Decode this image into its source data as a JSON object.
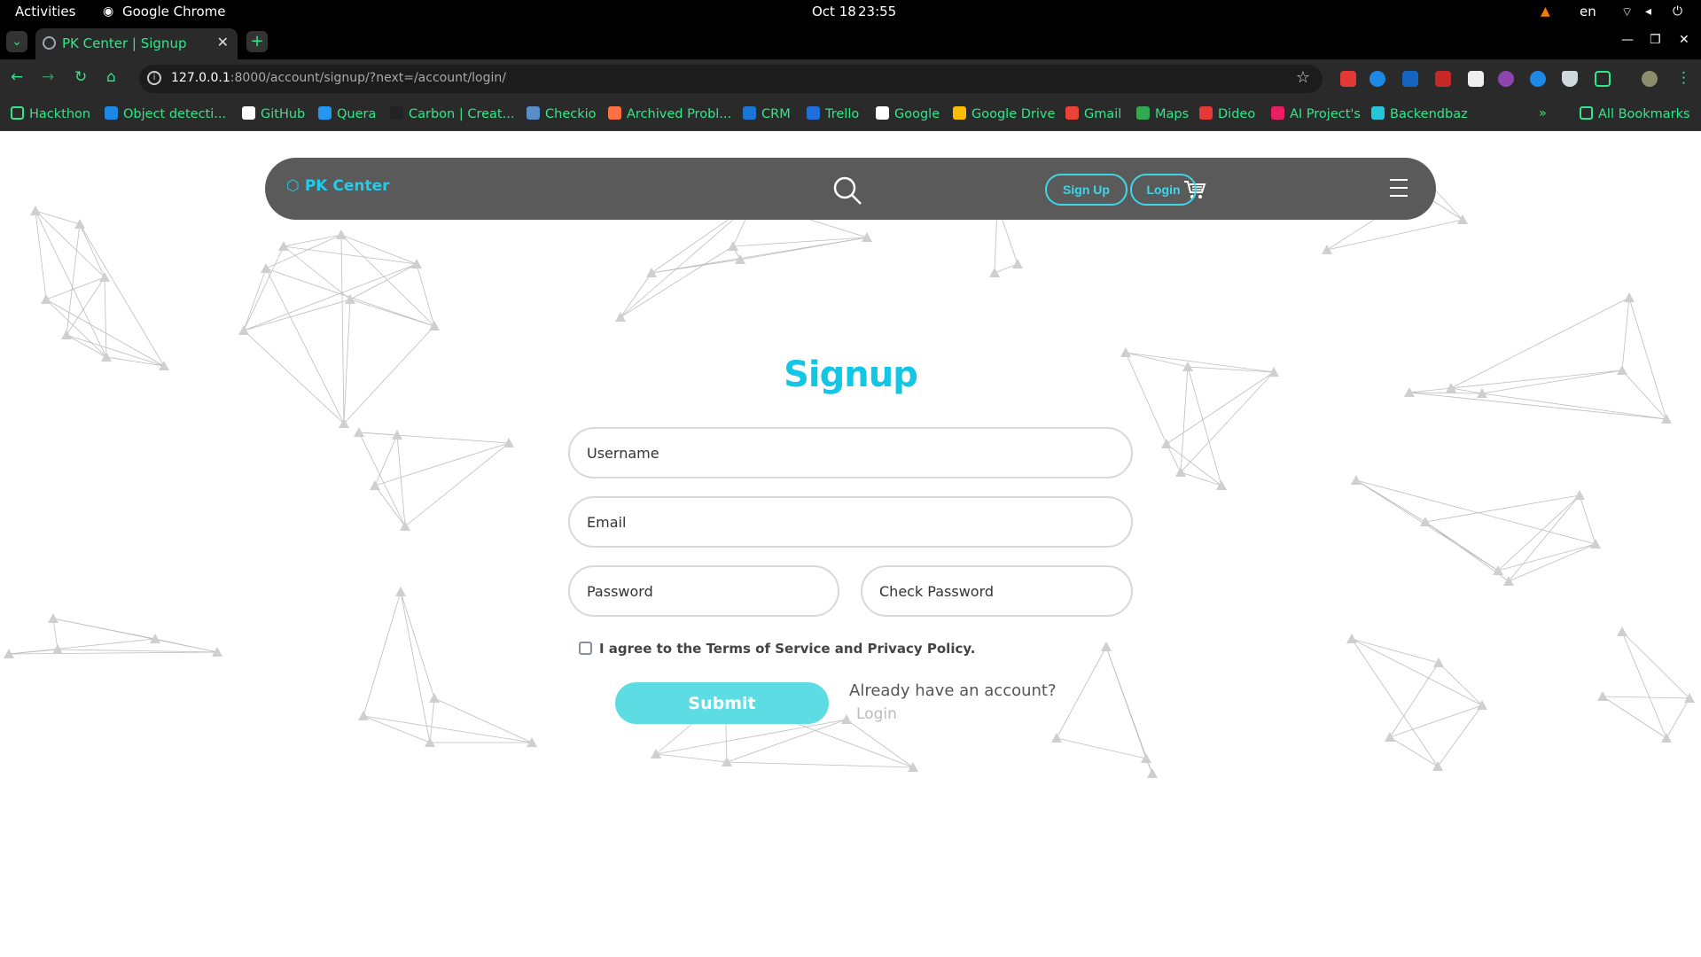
{
  "os": {
    "activities": "Activities",
    "app": "Google Chrome",
    "date": "Oct 18",
    "time": "23:55",
    "lang": "en"
  },
  "browser": {
    "tab_title": "PK Center | Signup",
    "url_host": "127.0.0.1",
    "url_path": ":8000/account/signup/?next=/account/login/",
    "bookmarks": [
      {
        "label": "Hackthon",
        "color": "#2ee889"
      },
      {
        "label": "Object detecti...",
        "color": "#1e88e5"
      },
      {
        "label": "GitHub",
        "color": "#ffffff"
      },
      {
        "label": "Quera",
        "color": "#2196f3"
      },
      {
        "label": "Carbon | Creat...",
        "color": "#222222"
      },
      {
        "label": "Checkio",
        "color": "#5b8ec7"
      },
      {
        "label": "Archived Probl...",
        "color": "#ff7043"
      },
      {
        "label": "CRM",
        "color": "#1976d2"
      },
      {
        "label": "Trello",
        "color": "#1e6fd9"
      },
      {
        "label": "Google",
        "color": "#ffffff"
      },
      {
        "label": "Google Drive",
        "color": "#fbbc04"
      },
      {
        "label": "Gmail",
        "color": "#ea4335"
      },
      {
        "label": "Maps",
        "color": "#34a853"
      },
      {
        "label": "Dideo",
        "color": "#e53935"
      },
      {
        "label": "AI Project's",
        "color": "#e91e63"
      },
      {
        "label": "Backendbaz",
        "color": "#26c6da"
      }
    ],
    "all_bookmarks": "All Bookmarks"
  },
  "site": {
    "brand": "PK Center",
    "signup_button": "Sign Up",
    "login_button": "Login",
    "accent": "#1fcde8"
  },
  "form": {
    "title": "Signup",
    "username_placeholder": "Username",
    "email_placeholder": "Email",
    "password_placeholder": "Password",
    "check_password_placeholder": "Check Password",
    "agree_text": "I agree to the Terms of Service and Privacy Policy.",
    "submit_label": "Submit",
    "already_text": "Already have an account?",
    "login_link": "Login"
  }
}
